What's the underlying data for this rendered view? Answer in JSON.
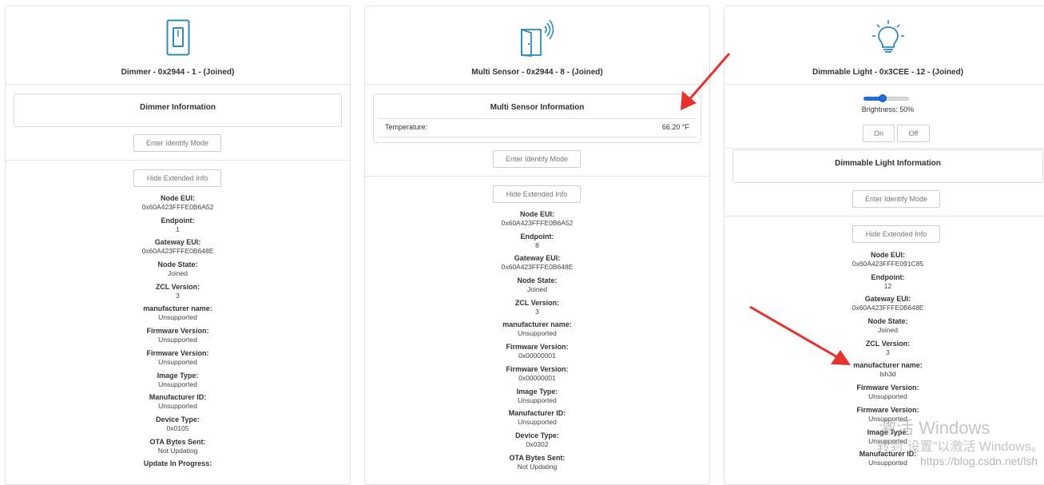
{
  "cards": [
    {
      "title": "Dimmer - 0x2944 - 1 - (Joined)",
      "icon": "light-switch-icon",
      "info_title": "Dimmer Information",
      "identify_label": "Enter Identify Mode",
      "hide_label": "Hide Extended Info",
      "extended": [
        {
          "label": "Node EUI:",
          "value": "0x60A423FFFE0B6A52"
        },
        {
          "label": "Endpoint:",
          "value": "1"
        },
        {
          "label": "Gateway EUI:",
          "value": "0x60A423FFFE0B648E"
        },
        {
          "label": "Node State:",
          "value": "Joined"
        },
        {
          "label": "ZCL Version:",
          "value": "3"
        },
        {
          "label": "manufacturer name:",
          "value": "Unsupported"
        },
        {
          "label": "Firmware Version:",
          "value": "Unsupported"
        },
        {
          "label": "Firmware Version:",
          "value": "Unsupported"
        },
        {
          "label": "Image Type:",
          "value": "Unsupported"
        },
        {
          "label": "Manufacturer ID:",
          "value": "Unsupported"
        },
        {
          "label": "Device Type:",
          "value": "0x0105"
        },
        {
          "label": "OTA Bytes Sent:",
          "value": "Not Updating"
        },
        {
          "label": "Update In Progress:",
          "value": ""
        }
      ]
    },
    {
      "title": "Multi Sensor - 0x2944 - 8 - (Joined)",
      "icon": "door-sensor-icon",
      "info_title": "Multi Sensor Information",
      "temp_label": "Temperature:",
      "temp_value": "66.20 °F",
      "identify_label": "Enter Identify Mode",
      "hide_label": "Hide Extended Info",
      "extended": [
        {
          "label": "Node EUI:",
          "value": "0x60A423FFFE0B6A52"
        },
        {
          "label": "Endpoint:",
          "value": "8"
        },
        {
          "label": "Gateway EUI:",
          "value": "0x60A423FFFE0B648E"
        },
        {
          "label": "Node State:",
          "value": "Joined"
        },
        {
          "label": "ZCL Version:",
          "value": "3"
        },
        {
          "label": "manufacturer name:",
          "value": "Unsupported"
        },
        {
          "label": "Firmware Version:",
          "value": "0x00000001"
        },
        {
          "label": "Firmware Version:",
          "value": "0x00000001"
        },
        {
          "label": "Image Type:",
          "value": "Unsupported"
        },
        {
          "label": "Manufacturer ID:",
          "value": "Unsupported"
        },
        {
          "label": "Device Type:",
          "value": "0x0302"
        },
        {
          "label": "OTA Bytes Sent:",
          "value": "Not Updating"
        }
      ]
    },
    {
      "title": "Dimmable Light - 0x3CEE - 12 - (Joined)",
      "icon": "light-bulb-icon",
      "brightness_label": "Brightness: 50%",
      "brightness_fraction": 0.5,
      "on_label": "On",
      "off_label": "Off",
      "info_title": "Dimmable Light Information",
      "identify_label": "Enter Identify Mode",
      "hide_label": "Hide Extended Info",
      "extended": [
        {
          "label": "Node EUI:",
          "value": "0x60A423FFFE091C85"
        },
        {
          "label": "Endpoint:",
          "value": "12"
        },
        {
          "label": "Gateway EUI:",
          "value": "0x60A423FFFE0B648E"
        },
        {
          "label": "Node State:",
          "value": "Joined"
        },
        {
          "label": "ZCL Version:",
          "value": "3"
        },
        {
          "label": "manufacturer name:",
          "value": "lsh3d"
        },
        {
          "label": "Firmware Version:",
          "value": "Unsupported"
        },
        {
          "label": "Firmware Version:",
          "value": "Unsupported"
        },
        {
          "label": "Image Type:",
          "value": "Unsupported"
        },
        {
          "label": "Manufacturer ID:",
          "value": "Unsupported"
        }
      ]
    }
  ],
  "overlay": {
    "watermark_line1": "激活 Windows",
    "watermark_line2": "转到\"设置\"以激活 Windows。",
    "csdn": "https://blog.csdn.net/lsh"
  },
  "colors": {
    "icon": "#2a8cb8",
    "slider": "#1e70d8",
    "arrow": "#e8302c"
  }
}
